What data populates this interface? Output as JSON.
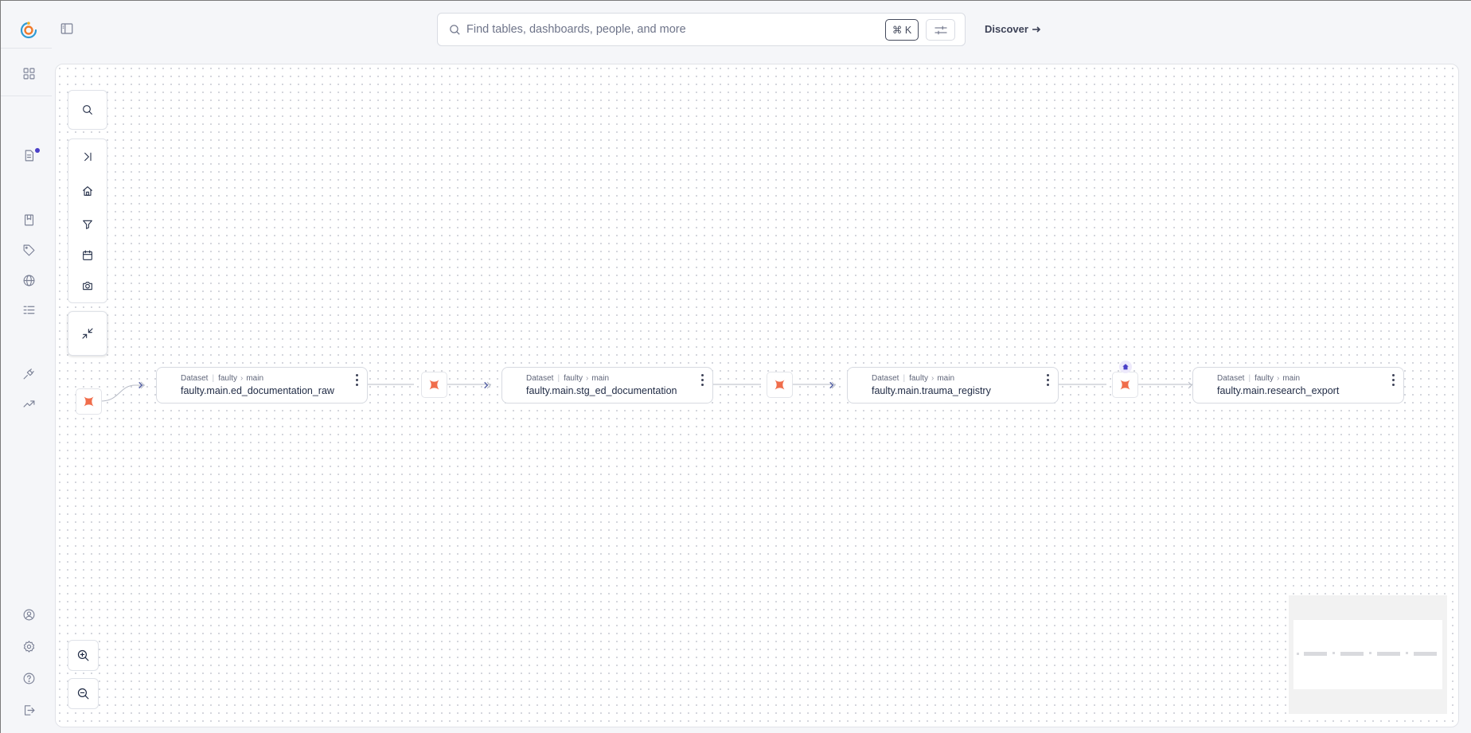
{
  "search": {
    "placeholder": "Find tables, dashboards, people, and more",
    "shortcut": "⌘ K"
  },
  "header": {
    "discover_label": "Discover"
  },
  "sidebar": {
    "icons": [
      "logo-icon",
      "grid-icon",
      "document-icon",
      "bookmark-icon",
      "tag-icon",
      "globe-icon",
      "list-icon",
      "plug-icon",
      "trending-icon",
      "user-icon",
      "settings-icon",
      "help-icon",
      "logout-icon"
    ]
  },
  "toolbar": {
    "tools": [
      "search-icon",
      "collapse-right-icon",
      "home-icon",
      "filter-icon",
      "calendar-icon",
      "camera-icon",
      "compress-icon"
    ],
    "zoom": [
      "zoom-in-icon",
      "zoom-out-icon"
    ]
  },
  "lineage": {
    "nodes": [
      {
        "type": "Dataset",
        "db": "faulty",
        "schema": "main",
        "name": "faulty.main.ed_documentation_raw"
      },
      {
        "type": "Dataset",
        "db": "faulty",
        "schema": "main",
        "name": "faulty.main.stg_ed_documentation"
      },
      {
        "type": "Dataset",
        "db": "faulty",
        "schema": "main",
        "name": "faulty.main.trauma_registry"
      },
      {
        "type": "Dataset",
        "db": "faulty",
        "schema": "main",
        "name": "faulty.main.research_export"
      }
    ]
  },
  "colors": {
    "accent": "#4a3fc7",
    "transform": "#f06d4b",
    "text": "#1f2a44"
  }
}
